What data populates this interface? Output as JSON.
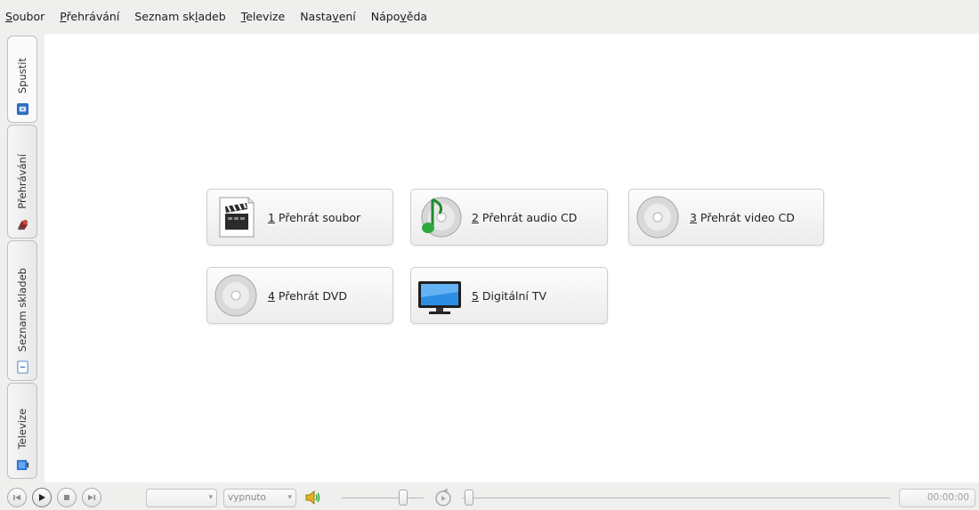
{
  "menu": [
    {
      "accel": "S",
      "rest": "oubor"
    },
    {
      "accel": "P",
      "rest": "řehrávání"
    },
    {
      "pre": "Seznam sk",
      "accel": "l",
      "rest": "adeb"
    },
    {
      "accel": "T",
      "rest": "elevize"
    },
    {
      "pre": "Nasta",
      "accel": "v",
      "rest": "ení"
    },
    {
      "pre": "Nápo",
      "accel": "v",
      "rest": "ěda"
    }
  ],
  "sidebar": {
    "tabs": [
      {
        "label": "Spustit",
        "icon": "start-icon"
      },
      {
        "label": "Přehrávání",
        "icon": "playback-icon"
      },
      {
        "label": "Seznam skladeb",
        "icon": "playlist-icon"
      },
      {
        "label": "Televize",
        "icon": "tv-icon"
      }
    ]
  },
  "launch_buttons": [
    {
      "accel": "1",
      "text": " Přehrát soubor",
      "icon": "film-clapper-icon"
    },
    {
      "accel": "2",
      "text": " Přehrát audio CD",
      "icon": "audio-cd-icon"
    },
    {
      "accel": "3",
      "text": " Přehrát video CD",
      "icon": "video-cd-icon"
    },
    {
      "accel": "4",
      "text": " Přehrát DVD",
      "icon": "dvd-icon"
    },
    {
      "accel": "5",
      "text": " Digitální TV",
      "icon": "monitor-icon"
    }
  ],
  "controls": {
    "chapter_combo": "",
    "deinterlace_combo": "vypnuto",
    "time": "00:00:00",
    "volume_level": 0.75,
    "position_level": 0.0
  },
  "colors": {
    "background": "#efefee",
    "content": "#ffffff",
    "accent_blue": "#2f6fc1"
  }
}
